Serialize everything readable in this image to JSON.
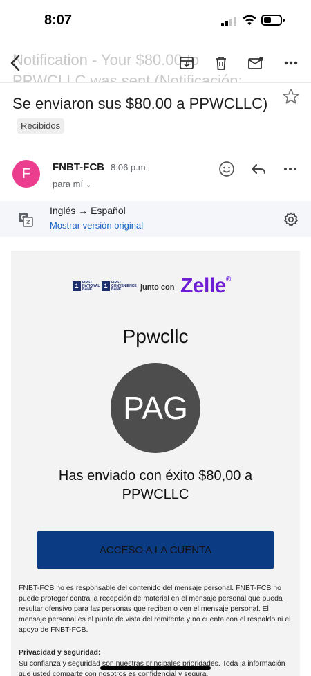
{
  "status_bar": {
    "time": "8:07"
  },
  "header": {
    "ghost_subject_line1": "Notification - Your $80.00 to",
    "ghost_subject_line2": "PPWCLLC was sent (Notificación:"
  },
  "subject": {
    "text": "Se enviaron sus $80.00 a PPWCLLC)",
    "label": "Recibidos"
  },
  "sender": {
    "initial": "F",
    "name": "FNBT-FCB",
    "time": "8:06 p.m.",
    "recipient": "para mí",
    "avatar_color": "#ec3e8f"
  },
  "translate": {
    "langs": "Inglés → Español",
    "link": "Mostrar versión original"
  },
  "email": {
    "junto": "junto con",
    "zelle": "Zelle",
    "zelle_color": "#6d1ed4",
    "payee": "Ppwcllc",
    "avatar_text": "PAG",
    "success": "Has enviado con éxito $80,00 a PPWCLLC",
    "button": "ACCESO A LA CUENTA",
    "button_color": "#0b3b83",
    "disclaimer": "FNBT-FCB no es responsable del contenido del mensaje personal. FNBT-FCB no puede proteger contra la recepción de material en el mensaje personal que pueda resultar ofensivo para las personas que reciben o ven el mensaje personal. El mensaje personal es el punto de vista del remitente y no cuenta con el respaldo ni el apoyo de FNBT-FCB.",
    "privacy_title": "Privacidad y seguridad:",
    "privacy_text": "Su confianza y seguridad son nuestras principales prioridades. Toda la información que usted comparte con nosotros es confidencial y segura."
  }
}
